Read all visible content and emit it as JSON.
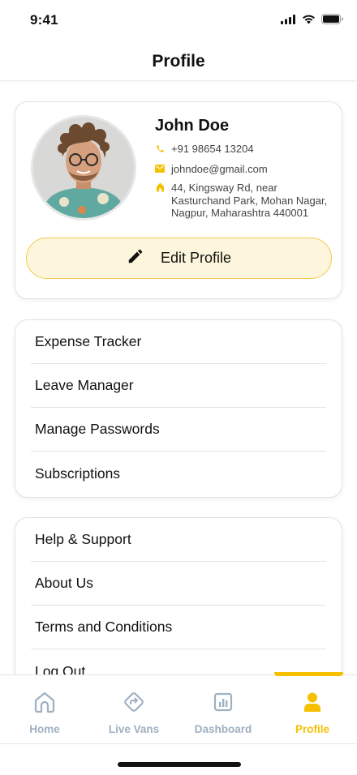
{
  "status_bar": {
    "time": "9:41"
  },
  "header": {
    "title": "Profile"
  },
  "profile": {
    "name": "John Doe",
    "phone": "+91 98654 13204",
    "email": "johndoe@gmail.com",
    "address_line1": "44, Kingsway Rd, near",
    "address_line2": "Kasturchand Park, Mohan Nagar,",
    "address_line3": "Nagpur, Maharashtra 440001",
    "edit_label": "Edit Profile"
  },
  "menu_group_1": [
    {
      "label": "Expense Tracker"
    },
    {
      "label": "Leave Manager"
    },
    {
      "label": "Manage Passwords"
    },
    {
      "label": "Subscriptions"
    }
  ],
  "menu_group_2": [
    {
      "label": "Help & Support"
    },
    {
      "label": "About Us"
    },
    {
      "label": "Terms and Conditions"
    },
    {
      "label": "Log Out"
    }
  ],
  "tabs": [
    {
      "label": "Home",
      "icon": "home-icon"
    },
    {
      "label": "Live Vans",
      "icon": "live-vans-icon"
    },
    {
      "label": "Dashboard",
      "icon": "dashboard-icon"
    },
    {
      "label": "Profile",
      "icon": "profile-icon",
      "active": true
    }
  ],
  "colors": {
    "accent": "#f6c000",
    "inactive": "#9fb0c2",
    "edit_bg": "#fdf6dc",
    "edit_border": "#f2c94c"
  }
}
